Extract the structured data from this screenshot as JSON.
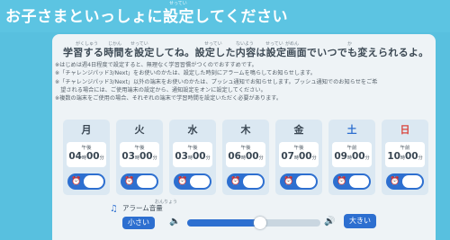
{
  "title": "お子さまといっしょに設定してください",
  "title_ruby": "せってい",
  "heading": "学習する時間を設定してね。設定した内容は設定画面でいつでも変えられるよ。",
  "heading_ruby": [
    "がくしゅう",
    "じかん",
    "せってい",
    "せってい",
    "ないよう",
    "せってい",
    "がめん",
    "か"
  ],
  "notes": [
    "※はじめは週4日程度で設定すると、無理なく学習習慣がつくのでおすすめです。",
    "※「チャレンジパッド3/Next」をお使いのかたは、設定した時刻にアラームを鳴らしてお知らせします。",
    "※「チャレンジパッド3/Next」以外の端末をお使いのかたは、プッシュ通知でお知らせします。プッシュ通知でのお知らせをご希",
    "　望される場合には、ご使用端末の設定から、通知設定をオンに設定してください。",
    "※複数の端末をご使用の場合、それぞれの端末で学習時間を設定いただく必要があります。"
  ],
  "days": [
    {
      "name": "月",
      "color": "#3a4753",
      "ampm": "午後",
      "hour": "04",
      "minute": "00",
      "h": "時",
      "m": "分",
      "enabled": true
    },
    {
      "name": "火",
      "color": "#3a4753",
      "ampm": "午後",
      "hour": "03",
      "minute": "00",
      "h": "時",
      "m": "分",
      "enabled": true
    },
    {
      "name": "水",
      "color": "#3a4753",
      "ampm": "午後",
      "hour": "03",
      "minute": "00",
      "h": "時",
      "m": "分",
      "enabled": true
    },
    {
      "name": "木",
      "color": "#3a4753",
      "ampm": "午後",
      "hour": "06",
      "minute": "00",
      "h": "時",
      "m": "分",
      "enabled": true
    },
    {
      "name": "金",
      "color": "#3a4753",
      "ampm": "午後",
      "hour": "07",
      "minute": "00",
      "h": "時",
      "m": "分",
      "enabled": true
    },
    {
      "name": "土",
      "color": "#2d6fd0",
      "ampm": "午前",
      "hour": "09",
      "minute": "00",
      "h": "時",
      "m": "分",
      "enabled": true
    },
    {
      "name": "日",
      "color": "#d9463e",
      "ampm": "午前",
      "hour": "10",
      "minute": "00",
      "h": "時",
      "m": "分",
      "enabled": true
    }
  ],
  "alarm": {
    "label": "アラーム音量",
    "label_ruby": "おんりょう",
    "quiet_label": "小さい",
    "loud_label": "大きい",
    "volume_fraction": 0.55
  },
  "colors": {
    "background": "#58c0df",
    "accent": "#2d6fd0",
    "saturday": "#2d6fd0",
    "sunday": "#d9463e"
  },
  "icons": {
    "toggle": "alarm-clock-icon",
    "alarm_label": "music-note-icon",
    "volume_low": "speaker-low-icon",
    "volume_high": "speaker-high-icon"
  }
}
